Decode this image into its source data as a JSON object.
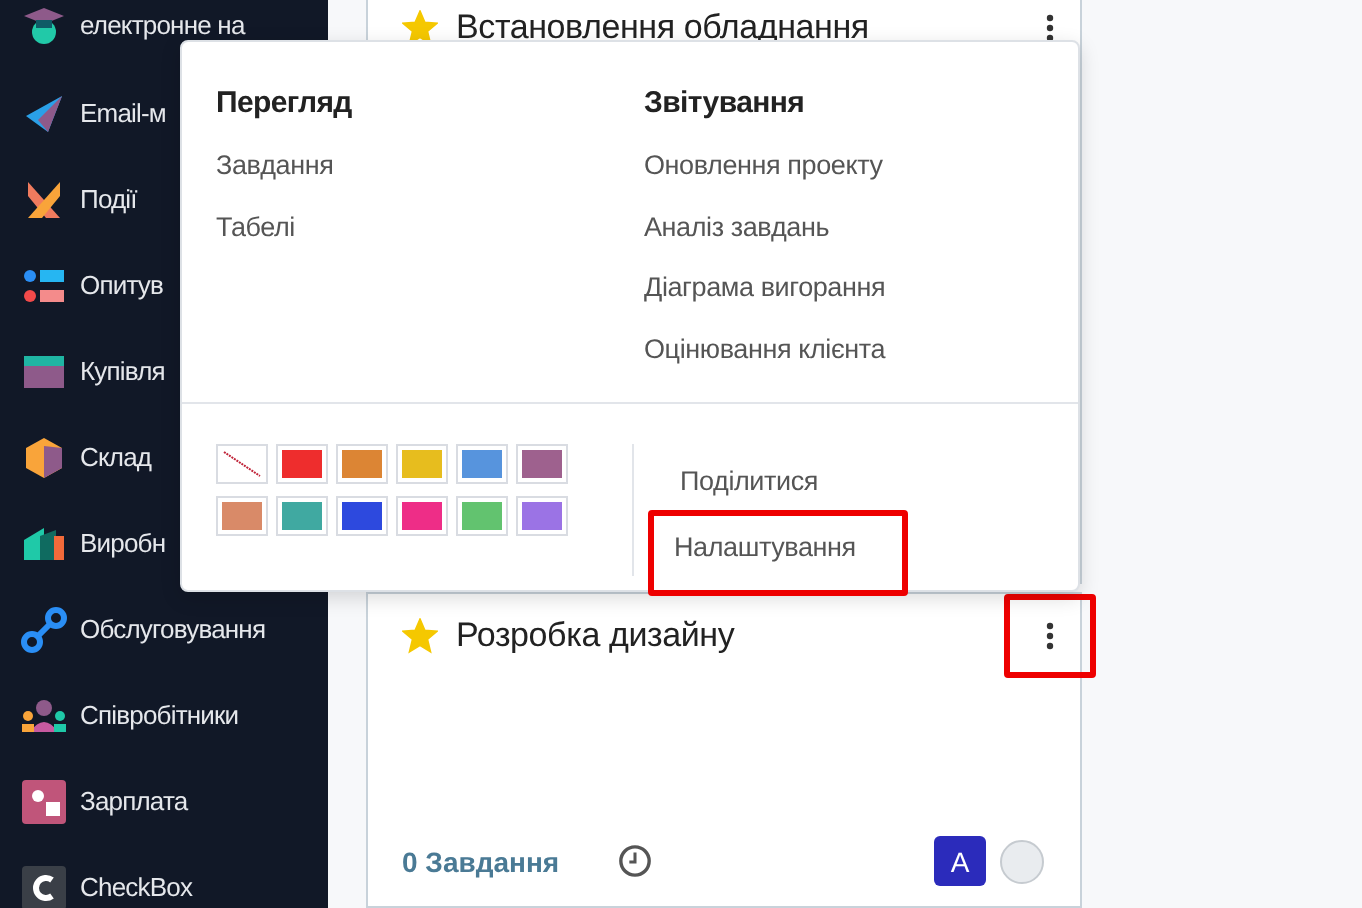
{
  "sidebar": {
    "items": [
      {
        "label": "електронне на"
      },
      {
        "label": "Email-м"
      },
      {
        "label": "Події"
      },
      {
        "label": "Опитув"
      },
      {
        "label": "Купівля"
      },
      {
        "label": "Склад"
      },
      {
        "label": "Виробн"
      },
      {
        "label": "Обслуговування"
      },
      {
        "label": "Співробітники"
      },
      {
        "label": "Зарплата"
      },
      {
        "label": "CheckBox"
      }
    ]
  },
  "projects": [
    {
      "title": "Встановлення обладнання",
      "favorite": true,
      "menu_highlighted": false
    },
    {
      "title": "Розробка дизайну",
      "favorite": true,
      "menu_highlighted": true,
      "task_count": "0",
      "task_label": "Завдання",
      "avatar": "A"
    }
  ],
  "dropdown": {
    "sections": [
      {
        "title": "Перегляд",
        "items": [
          "Завдання",
          "Табелі"
        ]
      },
      {
        "title": "Звітування",
        "items": [
          "Оновлення проекту",
          "Аналіз завдань",
          "Діаграма вигорання",
          "Оцінювання клієнта"
        ]
      }
    ],
    "colors": [
      {
        "kind": "none",
        "color": "#ffffff"
      },
      {
        "kind": "color",
        "color": "#ee2d2d"
      },
      {
        "kind": "color",
        "color": "#dc8534"
      },
      {
        "kind": "color",
        "color": "#e7bd1e"
      },
      {
        "kind": "color",
        "color": "#5794dd"
      },
      {
        "kind": "color",
        "color": "#9e618e"
      },
      {
        "kind": "color",
        "color": "#d98a68"
      },
      {
        "kind": "color",
        "color": "#40a9a1"
      },
      {
        "kind": "color",
        "color": "#2d49de"
      },
      {
        "kind": "color",
        "color": "#ee2d87"
      },
      {
        "kind": "color",
        "color": "#62c36f"
      },
      {
        "kind": "color",
        "color": "#9b73e5"
      }
    ],
    "actions": [
      {
        "label": "Поділитися",
        "highlighted": false
      },
      {
        "label": "Налаштування",
        "highlighted": true
      }
    ]
  }
}
